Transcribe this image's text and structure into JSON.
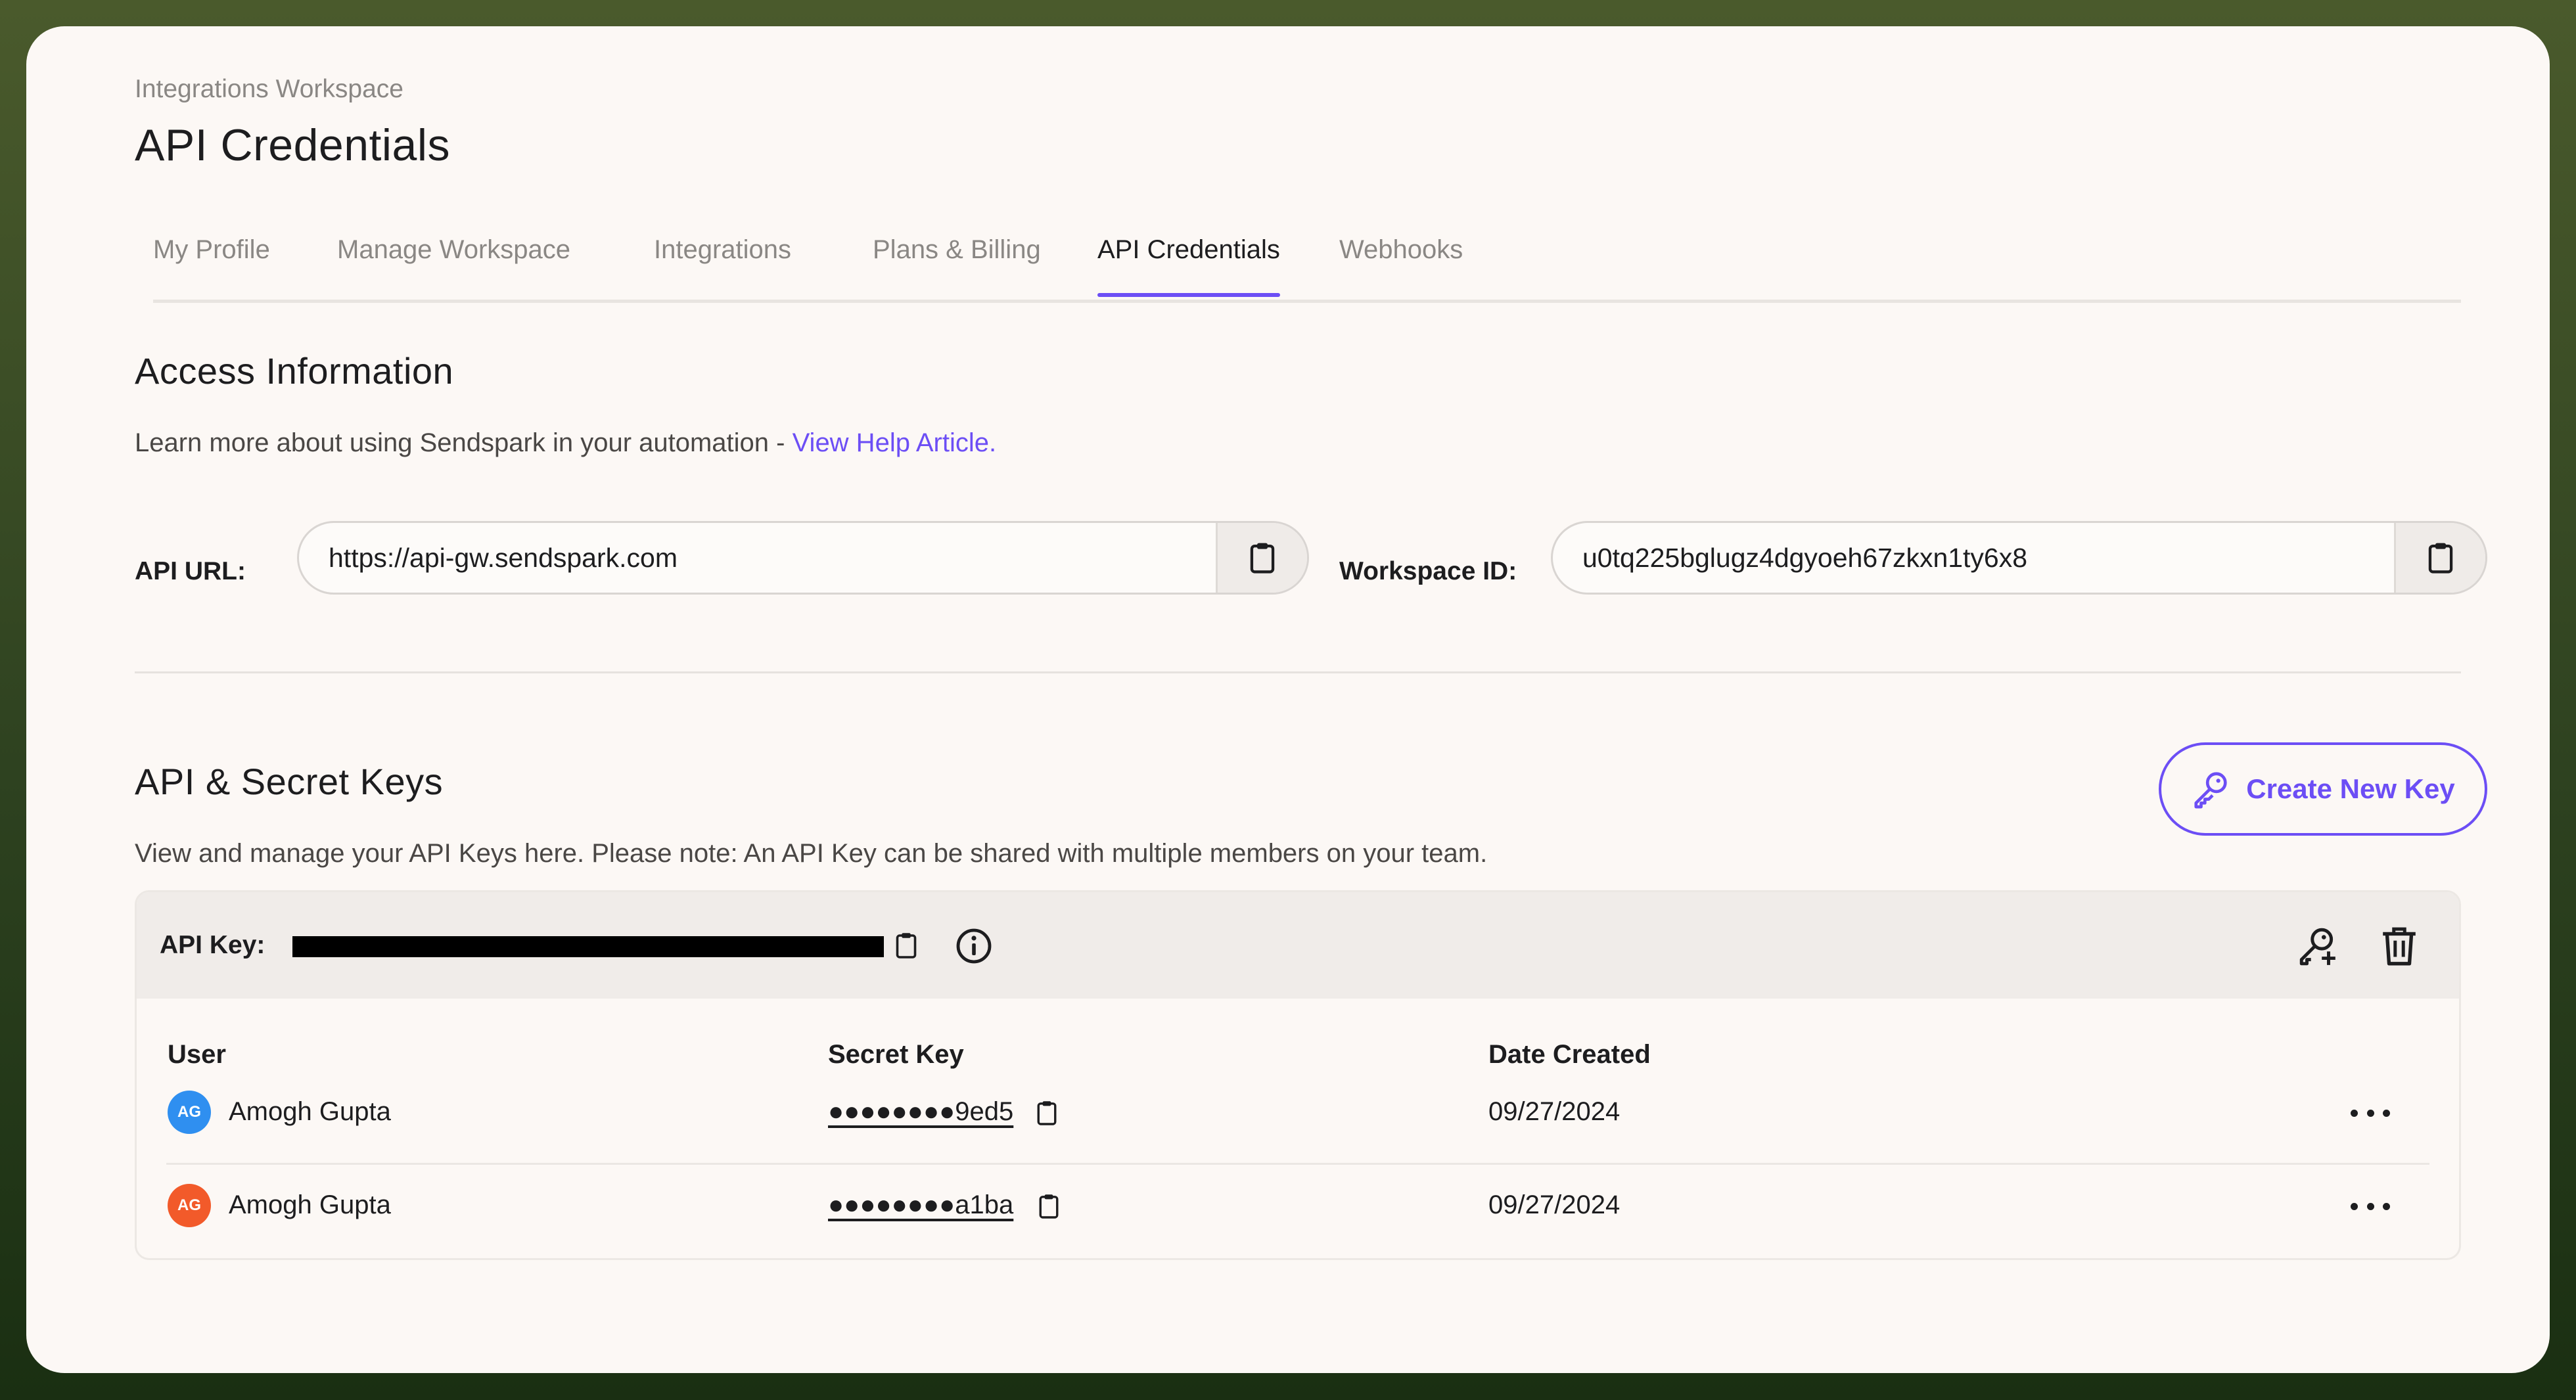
{
  "header": {
    "breadcrumb": "Integrations Workspace",
    "title": "API Credentials"
  },
  "tabs": [
    {
      "label": "My Profile",
      "active": false
    },
    {
      "label": "Manage Workspace",
      "active": false
    },
    {
      "label": "Integrations",
      "active": false
    },
    {
      "label": "Plans & Billing",
      "active": false
    },
    {
      "label": "API Credentials",
      "active": true
    },
    {
      "label": "Webhooks",
      "active": false
    }
  ],
  "access": {
    "title": "Access Information",
    "description": "Learn more about using Sendspark in your automation - ",
    "help_link": "View Help Article.",
    "api_url_label": "API URL:",
    "api_url_value": "https://api-gw.sendspark.com",
    "workspace_id_label": "Workspace ID:",
    "workspace_id_value": "u0tq225bglugz4dgyoeh67zkxn1ty6x8"
  },
  "keys": {
    "title": "API & Secret Keys",
    "description": "View and manage your API Keys here. Please note: An API Key can be shared with multiple members on your team.",
    "create_button": "Create New Key",
    "api_key_label": "API Key:",
    "columns": {
      "user": "User",
      "secret": "Secret Key",
      "date": "Date Created"
    },
    "rows": [
      {
        "initials": "AG",
        "user": "Amogh Gupta",
        "secret": "●●●●●●●●9ed5",
        "date": "09/27/2024",
        "avatar_color": "#2f8ff0"
      },
      {
        "initials": "AG",
        "user": "Amogh Gupta",
        "secret": "●●●●●●●●a1ba",
        "date": "09/27/2024",
        "avatar_color": "#f25a2a"
      }
    ]
  },
  "colors": {
    "accent": "#6c4ef5",
    "panel": "#fcf8f5",
    "frame": "#3a4d24"
  }
}
